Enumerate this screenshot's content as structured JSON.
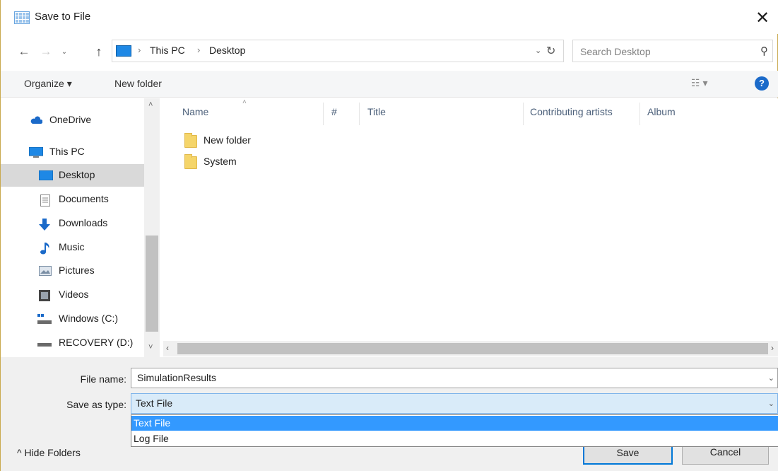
{
  "window": {
    "title": "Save to File",
    "close_glyph": "✕"
  },
  "nav": {
    "back_glyph": "←",
    "forward_glyph": "→",
    "recent_glyph": "⌄",
    "up_glyph": "↑"
  },
  "address": {
    "breadcrumbs": [
      "This PC",
      "Desktop"
    ],
    "separator": "›",
    "dropdown_glyph": "⌄",
    "refresh_glyph": "↻"
  },
  "search": {
    "placeholder": "Search Desktop",
    "icon_glyph": "⚲"
  },
  "toolbar": {
    "organize_label": "Organize ▾",
    "new_folder_label": "New folder",
    "view_label": "☷ ▾",
    "help_glyph": "?"
  },
  "sidebar": {
    "items": [
      {
        "label": "OneDrive",
        "icon": "onedrive-icon",
        "color": "#1b6ac9"
      },
      {
        "label": "This PC",
        "icon": "this-pc-icon",
        "color": "#1e88e5"
      },
      {
        "label": "Desktop",
        "icon": "desktop-icon",
        "color": "#1e88e5",
        "selected": true
      },
      {
        "label": "Documents",
        "icon": "documents-icon",
        "color": "#8a8a8a"
      },
      {
        "label": "Downloads",
        "icon": "downloads-icon",
        "color": "#1b6ac9"
      },
      {
        "label": "Music",
        "icon": "music-icon",
        "color": "#1b6ac9"
      },
      {
        "label": "Pictures",
        "icon": "pictures-icon",
        "color": "#7a8ea4"
      },
      {
        "label": "Videos",
        "icon": "videos-icon",
        "color": "#444444"
      },
      {
        "label": "Windows (C:)",
        "icon": "drive-c-icon",
        "color": "#6a6a6a"
      },
      {
        "label": "RECOVERY (D:)",
        "icon": "drive-d-icon",
        "color": "#6a6a6a"
      }
    ],
    "scroll_up_glyph": "˄",
    "scroll_down_glyph": "˅"
  },
  "columns": [
    "Name",
    "#",
    "Title",
    "Contributing artists",
    "Album"
  ],
  "sort_caret": "˄",
  "files": [
    {
      "name": "New folder",
      "icon": "folder-icon"
    },
    {
      "name": "System",
      "icon": "folder-icon"
    }
  ],
  "hscroll": {
    "left_glyph": "‹",
    "right_glyph": "›"
  },
  "form": {
    "file_name_label": "File name:",
    "file_name_value": "SimulationResults",
    "save_type_label": "Save as type:",
    "save_type_value": "Text File",
    "dropdown_glyph": "⌄",
    "type_options": [
      "Text File",
      "Log File"
    ]
  },
  "footer": {
    "hide_folders_label": "^  Hide Folders",
    "save_label": "Save",
    "cancel_label": "Cancel"
  },
  "colors": {
    "accent": "#0078d7",
    "selection": "#3399ff",
    "sidebar_selected": "#d9d9d9",
    "folder": "#f5d56a"
  }
}
